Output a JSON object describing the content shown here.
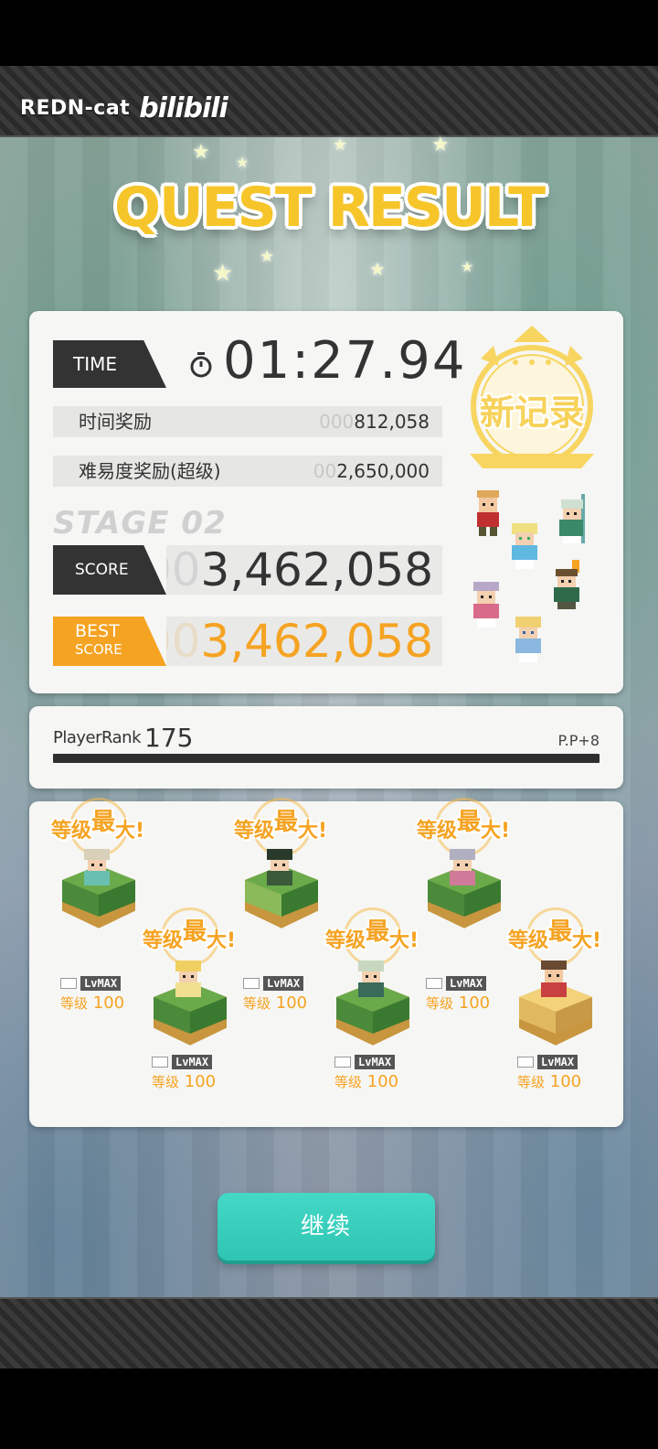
{
  "watermark": {
    "user": "REDN-cat",
    "brand": "bilibili"
  },
  "title": "QUEST RESULT",
  "time": {
    "tag": "TIME",
    "value": "01:27.94"
  },
  "bonuses": [
    {
      "label": "时间奖励",
      "prefix": "000",
      "value": "812,058"
    },
    {
      "label": "难易度奖励(超级)",
      "prefix": "00",
      "value": "2,650,000"
    }
  ],
  "stage": "STAGE 02",
  "score": {
    "tag": "SCORE",
    "prefix": "00",
    "value": "3,462,058"
  },
  "best": {
    "tag_line1": "BEST",
    "tag_line2": "SCORE",
    "prefix": "00",
    "value": "3,462,058"
  },
  "new_record": "新记录",
  "player_rank": {
    "label": "PlayerRank",
    "value": "175",
    "pp": "P.P+8",
    "progress": 1.0
  },
  "units": [
    {
      "max_text": "等级",
      "max_big": "最",
      "max_end": "大!",
      "badge": "LvMAX",
      "level_word": "等级",
      "level": "100",
      "block": "green"
    },
    {
      "max_text": "等级",
      "max_big": "最",
      "max_end": "大!",
      "badge": "LvMAX",
      "level_word": "等级",
      "level": "100",
      "block": "green"
    },
    {
      "max_text": "等级",
      "max_big": "最",
      "max_end": "大!",
      "badge": "LvMAX",
      "level_word": "等级",
      "level": "100",
      "block": "green"
    },
    {
      "max_text": "等级",
      "max_big": "最",
      "max_end": "大!",
      "badge": "LvMAX",
      "level_word": "等级",
      "level": "100",
      "block": "green"
    },
    {
      "max_text": "等级",
      "max_big": "最",
      "max_end": "大!",
      "badge": "LvMAX",
      "level_word": "等级",
      "level": "100",
      "block": "green"
    },
    {
      "max_text": "等级",
      "max_big": "最",
      "max_end": "大!",
      "badge": "LvMAX",
      "level_word": "等级",
      "level": "100",
      "block": "gold"
    }
  ],
  "continue_label": "继续",
  "colors": {
    "accent_orange": "#f5a322",
    "title_gold": "#f6c52a",
    "button_teal": "#33c9b7",
    "dark_tag": "#333333"
  }
}
